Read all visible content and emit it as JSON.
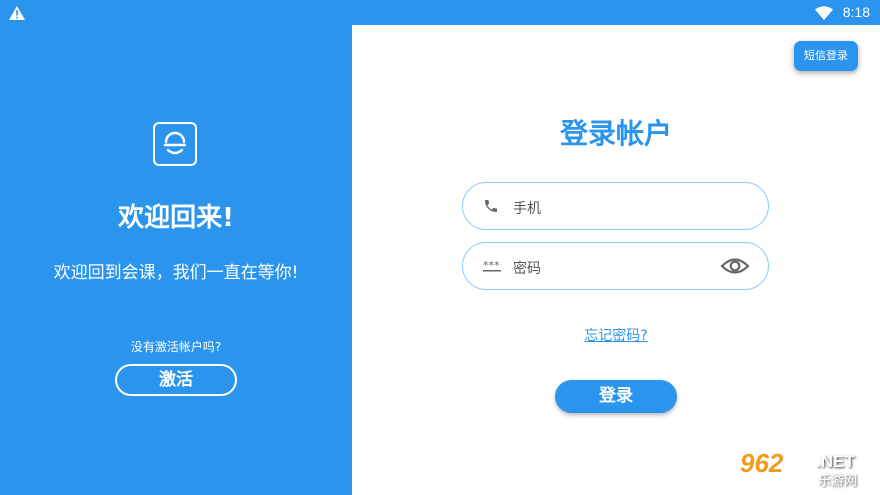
{
  "status_bar": {
    "time": "8:18"
  },
  "left_panel": {
    "title": "欢迎回来!",
    "subtitle": "欢迎回到会课，我们一直在等你!",
    "no_account_text": "没有激活帐户吗?",
    "activate_label": "激活"
  },
  "login": {
    "sms_login_label": "短信登录",
    "title": "登录帐户",
    "phone_placeholder": "手机",
    "password_placeholder": "密码",
    "forgot_label": "忘记密码?",
    "login_label": "登录"
  },
  "watermark": {
    "number": "962",
    "domain": ".NET",
    "text": "乐游网"
  },
  "colors": {
    "accent": "#2b95ee",
    "field_border": "#8ecbf5",
    "watermark": "#f39b1a"
  }
}
